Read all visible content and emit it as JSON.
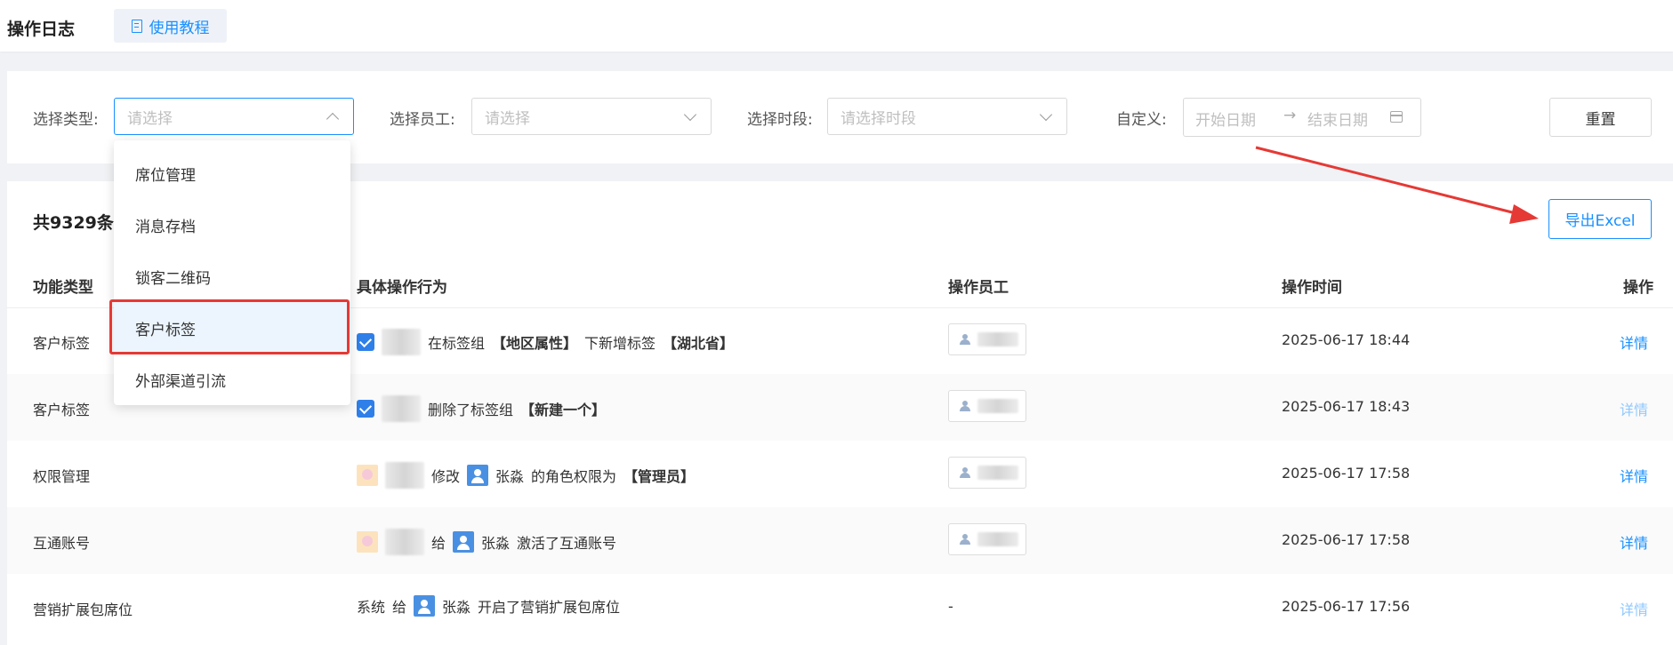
{
  "header": {
    "title": "操作日志",
    "tutorial_label": "使用教程"
  },
  "filters": {
    "type_label": "选择类型:",
    "type_placeholder": "请选择",
    "staff_label": "选择员工:",
    "staff_placeholder": "请选择",
    "period_label": "选择时段:",
    "period_placeholder": "请选择时段",
    "custom_label": "自定义:",
    "start_placeholder": "开始日期",
    "range_arrow": "→",
    "end_placeholder": "结束日期",
    "reset_label": "重置"
  },
  "dropdown": {
    "options": [
      "席位管理",
      "消息存档",
      "锁客二维码",
      "客户标签",
      "外部渠道引流"
    ],
    "highlighted": "客户标签"
  },
  "list": {
    "total_text": "共9329条数",
    "export_label": "导出Excel",
    "columns": [
      "功能类型",
      "具体操作行为",
      "操作员工",
      "操作时间",
      "操作"
    ],
    "rows": [
      {
        "type": "客户标签",
        "icon": "check-icon",
        "act_a": "在标签组",
        "act_b": "【地区属性】",
        "act_c": "下新增标签",
        "act_d": "【湖北省】",
        "time": "2025-06-17 18:44",
        "detail": "详情"
      },
      {
        "type": "客户标签",
        "icon": "check-icon",
        "act_a": "删除了标签组",
        "act_b": "【新建一个】",
        "time": "2025-06-17 18:43",
        "detail": "详情"
      },
      {
        "type": "权限管理",
        "icon": "avatar-icon",
        "act_a": "修改",
        "target": "张淼",
        "act_b": "的角色权限为",
        "act_c": "【管理员】",
        "time": "2025-06-17 17:58",
        "detail": "详情"
      },
      {
        "type": "互通账号",
        "icon": "avatar-icon",
        "act_a": "给",
        "target": "张淼",
        "act_b": "激活了互通账号",
        "time": "2025-06-17 17:58",
        "detail": "详情"
      },
      {
        "type": "营销扩展包席位",
        "actor": "系统",
        "act_a": "给",
        "target": "张淼",
        "act_b": "开启了营销扩展包席位",
        "employee": "-",
        "time": "2025-06-17 17:56",
        "detail": "详情"
      }
    ]
  },
  "colors": {
    "accent": "#1890ff",
    "annotation_red": "#e53935"
  }
}
